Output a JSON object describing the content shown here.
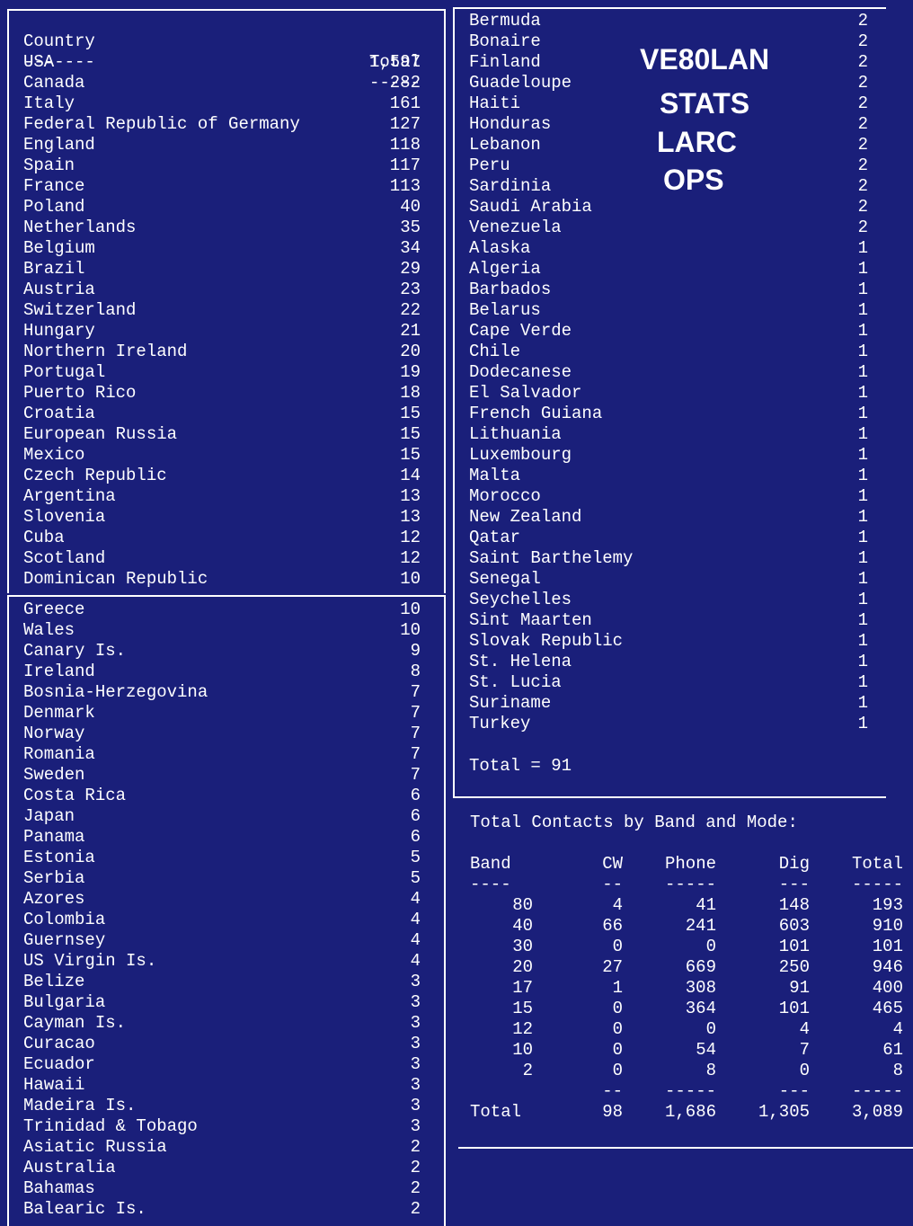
{
  "panel_a": {
    "header": {
      "country": "Country",
      "total": "Total"
    },
    "divider": {
      "country": "-------",
      "total": "-----"
    },
    "rows": [
      {
        "country": "USA",
        "total": "1,597"
      },
      {
        "country": "Canada",
        "total": "282"
      },
      {
        "country": "Italy",
        "total": "161"
      },
      {
        "country": "Federal Republic of Germany",
        "total": "127"
      },
      {
        "country": "England",
        "total": "118"
      },
      {
        "country": "Spain",
        "total": "117"
      },
      {
        "country": "France",
        "total": "113"
      },
      {
        "country": "Poland",
        "total": "40"
      },
      {
        "country": "Netherlands",
        "total": "35"
      },
      {
        "country": "Belgium",
        "total": "34"
      },
      {
        "country": "Brazil",
        "total": "29"
      },
      {
        "country": "Austria",
        "total": "23"
      },
      {
        "country": "Switzerland",
        "total": "22"
      },
      {
        "country": "Hungary",
        "total": "21"
      },
      {
        "country": "Northern Ireland",
        "total": "20"
      },
      {
        "country": "Portugal",
        "total": "19"
      },
      {
        "country": "Puerto Rico",
        "total": "18"
      },
      {
        "country": "Croatia",
        "total": "15"
      },
      {
        "country": "European Russia",
        "total": "15"
      },
      {
        "country": "Mexico",
        "total": "15"
      },
      {
        "country": "Czech Republic",
        "total": "14"
      },
      {
        "country": "Argentina",
        "total": "13"
      },
      {
        "country": "Slovenia",
        "total": "13"
      },
      {
        "country": "Cuba",
        "total": "12"
      },
      {
        "country": "Scotland",
        "total": "12"
      },
      {
        "country": "Dominican Republic",
        "total": "10"
      }
    ]
  },
  "panel_b": {
    "rows": [
      {
        "country": "Greece",
        "total": "10"
      },
      {
        "country": "Wales",
        "total": "10"
      },
      {
        "country": "Canary Is.",
        "total": "9"
      },
      {
        "country": "Ireland",
        "total": "8"
      },
      {
        "country": "Bosnia-Herzegovina",
        "total": "7"
      },
      {
        "country": "Denmark",
        "total": "7"
      },
      {
        "country": "Norway",
        "total": "7"
      },
      {
        "country": "Romania",
        "total": "7"
      },
      {
        "country": "Sweden",
        "total": "7"
      },
      {
        "country": "Costa Rica",
        "total": "6"
      },
      {
        "country": "Japan",
        "total": "6"
      },
      {
        "country": "Panama",
        "total": "6"
      },
      {
        "country": "Estonia",
        "total": "5"
      },
      {
        "country": "Serbia",
        "total": "5"
      },
      {
        "country": "Azores",
        "total": "4"
      },
      {
        "country": "Colombia",
        "total": "4"
      },
      {
        "country": "Guernsey",
        "total": "4"
      },
      {
        "country": "US Virgin Is.",
        "total": "4"
      },
      {
        "country": "Belize",
        "total": "3"
      },
      {
        "country": "Bulgaria",
        "total": "3"
      },
      {
        "country": "Cayman Is.",
        "total": "3"
      },
      {
        "country": "Curacao",
        "total": "3"
      },
      {
        "country": "Ecuador",
        "total": "3"
      },
      {
        "country": "Hawaii",
        "total": "3"
      },
      {
        "country": "Madeira Is.",
        "total": "3"
      },
      {
        "country": "Trinidad & Tobago",
        "total": "3"
      },
      {
        "country": "Asiatic Russia",
        "total": "2"
      },
      {
        "country": "Australia",
        "total": "2"
      },
      {
        "country": "Bahamas",
        "total": "2"
      },
      {
        "country": "Balearic Is.",
        "total": "2"
      }
    ]
  },
  "panel_c": {
    "rows": [
      {
        "country": "Bermuda",
        "total": "2"
      },
      {
        "country": "Bonaire",
        "total": "2"
      },
      {
        "country": "Finland",
        "total": "2"
      },
      {
        "country": "Guadeloupe",
        "total": "2"
      },
      {
        "country": "Haiti",
        "total": "2"
      },
      {
        "country": "Honduras",
        "total": "2"
      },
      {
        "country": "Lebanon",
        "total": "2"
      },
      {
        "country": "Peru",
        "total": "2"
      },
      {
        "country": "Sardinia",
        "total": "2"
      },
      {
        "country": "Saudi Arabia",
        "total": "2"
      },
      {
        "country": "Venezuela",
        "total": "2"
      },
      {
        "country": "Alaska",
        "total": "1"
      },
      {
        "country": "Algeria",
        "total": "1"
      },
      {
        "country": "Barbados",
        "total": "1"
      },
      {
        "country": "Belarus",
        "total": "1"
      },
      {
        "country": "Cape Verde",
        "total": "1"
      },
      {
        "country": "Chile",
        "total": "1"
      },
      {
        "country": "Dodecanese",
        "total": "1"
      },
      {
        "country": "El Salvador",
        "total": "1"
      },
      {
        "country": "French Guiana",
        "total": "1"
      },
      {
        "country": "Lithuania",
        "total": "1"
      },
      {
        "country": "Luxembourg",
        "total": "1"
      },
      {
        "country": "Malta",
        "total": "1"
      },
      {
        "country": "Morocco",
        "total": "1"
      },
      {
        "country": "New Zealand",
        "total": "1"
      },
      {
        "country": "Qatar",
        "total": "1"
      },
      {
        "country": "Saint Barthelemy",
        "total": "1"
      },
      {
        "country": "Senegal",
        "total": "1"
      },
      {
        "country": "Seychelles",
        "total": "1"
      },
      {
        "country": "Sint Maarten",
        "total": "1"
      },
      {
        "country": "Slovak Republic",
        "total": "1"
      },
      {
        "country": "St. Helena",
        "total": "1"
      },
      {
        "country": "St. Lucia",
        "total": "1"
      },
      {
        "country": "Suriname",
        "total": "1"
      },
      {
        "country": "Turkey",
        "total": "1"
      }
    ],
    "total_line": "Total = 91"
  },
  "heading": {
    "line1": "VE80LAN",
    "line2": "STATS",
    "line3": "LARC",
    "line4": "OPS"
  },
  "band_mode": {
    "title": "Total Contacts by Band and Mode:",
    "header": {
      "band": "Band",
      "cw": "CW",
      "phone": "Phone",
      "dig": "Dig",
      "total": "Total"
    },
    "divider": {
      "band": "----",
      "cw": "--",
      "phone": "-----",
      "dig": "---",
      "total": "-----"
    },
    "rows": [
      {
        "band": "80",
        "cw": "4",
        "phone": "41",
        "dig": "148",
        "total": "193"
      },
      {
        "band": "40",
        "cw": "66",
        "phone": "241",
        "dig": "603",
        "total": "910"
      },
      {
        "band": "30",
        "cw": "0",
        "phone": "0",
        "dig": "101",
        "total": "101"
      },
      {
        "band": "20",
        "cw": "27",
        "phone": "669",
        "dig": "250",
        "total": "946"
      },
      {
        "band": "17",
        "cw": "1",
        "phone": "308",
        "dig": "91",
        "total": "400"
      },
      {
        "band": "15",
        "cw": "0",
        "phone": "364",
        "dig": "101",
        "total": "465"
      },
      {
        "band": "12",
        "cw": "0",
        "phone": "0",
        "dig": "4",
        "total": "4"
      },
      {
        "band": "10",
        "cw": "0",
        "phone": "54",
        "dig": "7",
        "total": "61"
      },
      {
        "band": "2",
        "cw": "0",
        "phone": "8",
        "dig": "0",
        "total": "8"
      }
    ],
    "footer_divider": {
      "band": "",
      "cw": "--",
      "phone": "-----",
      "dig": "---",
      "total": "-----"
    },
    "totals": {
      "band": "Total",
      "cw": "98",
      "phone": "1,686",
      "dig": "1,305",
      "total": "3,089"
    }
  },
  "colors": {
    "background": "#1a1f7a",
    "text": "#ffffff"
  }
}
